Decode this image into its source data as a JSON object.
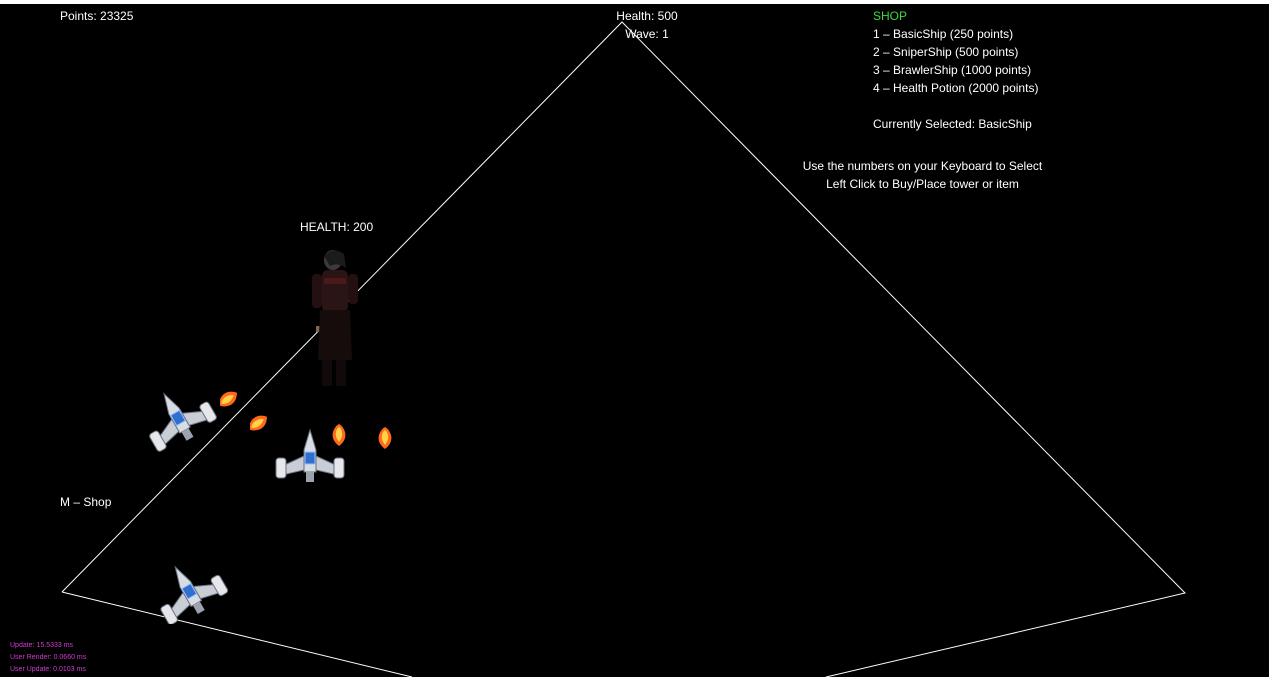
{
  "hud": {
    "points": "Points: 23325",
    "base_health": "Health: 500",
    "wave": "Wave: 1",
    "shop_hint": "M – Shop"
  },
  "shop": {
    "title": "SHOP",
    "items": [
      "1 – BasicShip (250 points)",
      "2 – SniperShip (500 points)",
      "3 – BrawlerShip (1000 points)",
      "4 – Health Potion (2000 points)"
    ],
    "selected": "Currently Selected: BasicShip",
    "instructions": [
      "Use the numbers on your Keyboard to Select",
      "Left Click to Buy/Place tower or item"
    ]
  },
  "enemy": {
    "health_label": "HEALTH: 200",
    "sprite": "dark-cloaked-warrior"
  },
  "ships": [
    {
      "sprite": "basic-ship-icon"
    },
    {
      "sprite": "basic-ship-icon"
    },
    {
      "sprite": "basic-ship-icon"
    }
  ],
  "projectiles": [
    {
      "sprite": "fireball-icon"
    },
    {
      "sprite": "fireball-icon"
    },
    {
      "sprite": "fireball-icon"
    },
    {
      "sprite": "fireball-icon"
    }
  ],
  "debug": [
    "Update: 15.5333 ms",
    "User Render: 0.0660 ms",
    "User Update: 0.0103 ms"
  ],
  "colors": {
    "shop_title": "#3ddc3d",
    "debug_text": "#d23ad2",
    "arena_line": "#ffffff",
    "background": "#000000"
  }
}
